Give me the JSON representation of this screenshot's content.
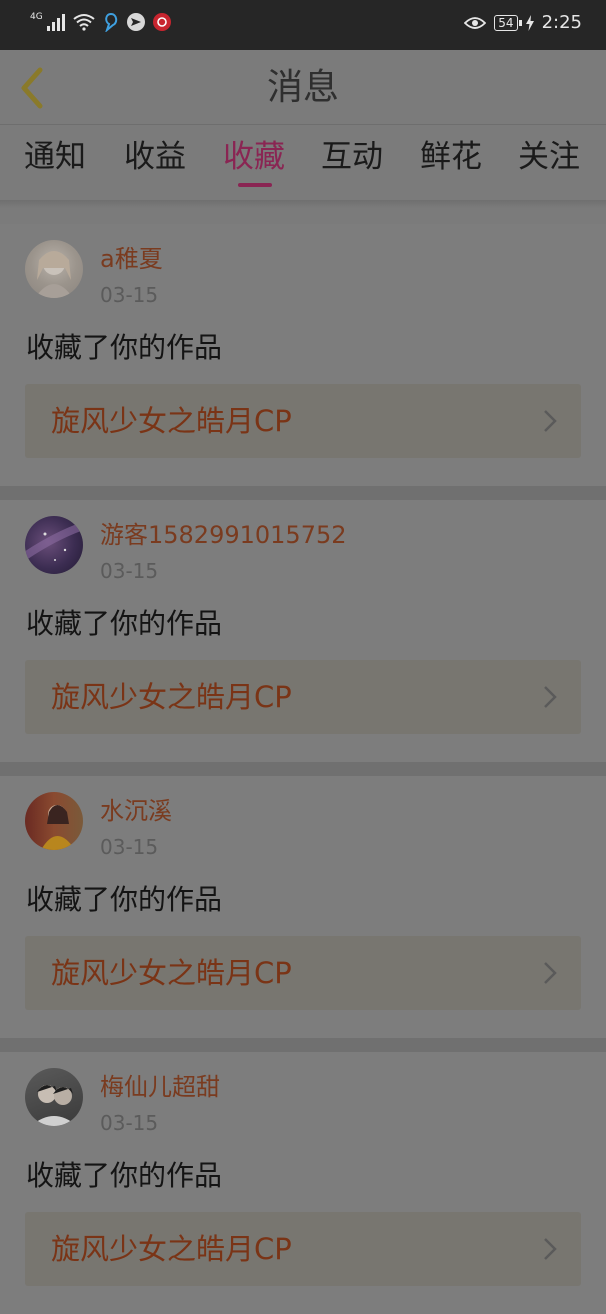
{
  "status_bar": {
    "network": "4G",
    "battery": "54",
    "time": "2:25",
    "icons": [
      "signal-icon",
      "wifi-icon",
      "app-notification-icon",
      "send-icon",
      "music-app-icon",
      "eye-icon",
      "battery-icon",
      "charging-icon"
    ]
  },
  "header": {
    "title": "消息",
    "back_icon": "chevron-left-icon"
  },
  "tabs": {
    "items": [
      {
        "label": "通知"
      },
      {
        "label": "收益"
      },
      {
        "label": "收藏"
      },
      {
        "label": "互动"
      },
      {
        "label": "鲜花"
      },
      {
        "label": "关注"
      }
    ],
    "active": "收藏"
  },
  "messages": [
    {
      "username": "a稚夏",
      "date": "03-15",
      "action": "收藏了你的作品",
      "work_title": "旋风少女之皓月CP"
    },
    {
      "username": "游客1582991015752",
      "date": "03-15",
      "action": "收藏了你的作品",
      "work_title": "旋风少女之皓月CP"
    },
    {
      "username": "水沉溪",
      "date": "03-15",
      "action": "收藏了你的作品",
      "work_title": "旋风少女之皓月CP"
    },
    {
      "username": "梅仙儿超甜",
      "date": "03-15",
      "action": "收藏了你的作品",
      "work_title": "旋风少女之皓月CP"
    }
  ],
  "colors": {
    "status_bar_bg": "#262626",
    "page_bg": "#7b7b7b",
    "accent": "#8a2553",
    "username": "#7a3b1f",
    "work_link_bg": "#787670"
  }
}
